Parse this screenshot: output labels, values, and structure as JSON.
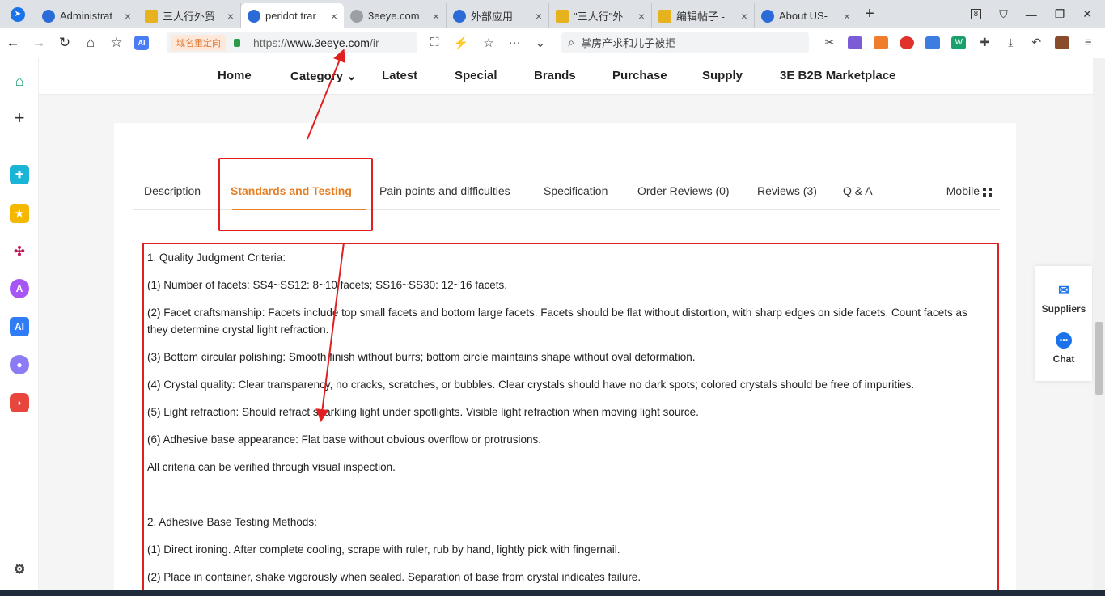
{
  "browser": {
    "tabs": [
      {
        "label": "Administrat",
        "favicon": "blue-logo-icon",
        "active": false
      },
      {
        "label": "三人行外贸",
        "favicon": "gold-icon",
        "active": false
      },
      {
        "label": "peridot trar",
        "favicon": "blue-logo-icon",
        "active": true
      },
      {
        "label": "3eeye.com",
        "favicon": "globe-icon",
        "active": false
      },
      {
        "label": "外部应用",
        "favicon": "blue-logo-icon",
        "active": false
      },
      {
        "label": "\"三人行\"外",
        "favicon": "gold-icon",
        "active": false
      },
      {
        "label": "编辑帖子 -",
        "favicon": "gold-icon",
        "active": false
      },
      {
        "label": "About US-",
        "favicon": "blue-logo-icon",
        "active": false
      }
    ],
    "new_tab": "+",
    "tab_count_badge": "8",
    "address": {
      "redirect_tag": "域名重定向",
      "url_prefix": "https://",
      "url_host": "www.3eeye.com",
      "url_path": "/ir"
    },
    "search_placeholder": "掌房产求和儿子被拒"
  },
  "site_nav": {
    "items": [
      "Home",
      "Category",
      "Latest",
      "Special",
      "Brands",
      "Purchase",
      "Supply",
      "3E B2B Marketplace"
    ]
  },
  "product_tabs": {
    "items": [
      {
        "label": "Description",
        "active": false
      },
      {
        "label": "Standards and Testing",
        "active": true
      },
      {
        "label": "Pain points and difficulties",
        "active": false
      },
      {
        "label": "Specification",
        "active": false
      },
      {
        "label": "Order Reviews (0)",
        "active": false
      },
      {
        "label": "Reviews (3)",
        "active": false
      },
      {
        "label": "Q & A",
        "active": false
      }
    ],
    "mobile_label": "Mobile"
  },
  "content": {
    "lines": [
      "1. Quality Judgment Criteria:",
      "(1) Number of facets: SS4~SS12: 8~10 facets; SS16~SS30: 12~16 facets.",
      "(2) Facet craftsmanship: Facets include top small facets and bottom large facets. Facets should be flat without distortion, with sharp edges on side facets. Count facets as they determine crystal light refraction.",
      "(3) Bottom circular polishing: Smooth finish without burrs; bottom circle maintains shape without oval deformation.",
      "(4) Crystal quality: Clear transparency, no cracks, scratches, or bubbles. Clear crystals should have no dark spots; colored crystals should be free of impurities.",
      "(5) Light refraction: Should refract sparkling light under spotlights. Visible light refraction when moving light source.",
      "(6) Adhesive base appearance: Flat base without obvious overflow or protrusions.",
      "All criteria can be verified through visual inspection.",
      "2. Adhesive Base Testing Methods:",
      "(1) Direct ironing. After complete cooling, scrape with ruler, rub by hand, lightly pick with fingernail.",
      "(2) Place in container, shake vigorously when sealed. Separation of base from crystal indicates failure."
    ]
  },
  "float_panel": {
    "suppliers_label": "Suppliers",
    "chat_label": "Chat"
  },
  "colors": {
    "accent_orange": "#e67e22",
    "annotation_red": "#e02020",
    "brand_blue": "#1a73e8"
  }
}
